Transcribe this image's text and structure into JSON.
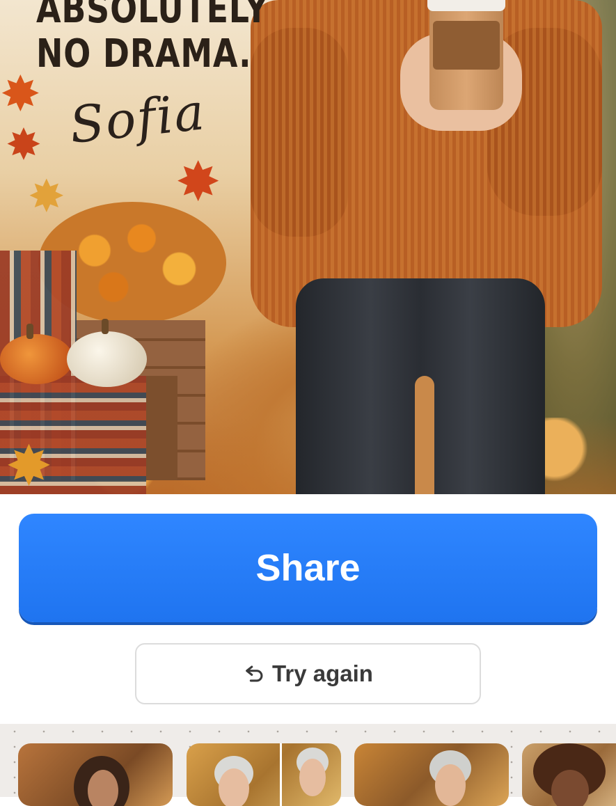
{
  "hero": {
    "headline_lines": [
      "ABSOLUTELY",
      "NO DRAMA."
    ],
    "signature": "Sofia"
  },
  "actions": {
    "share_label": "Share",
    "try_again_label": "Try again",
    "try_again_icon": "undo-arrow-icon"
  },
  "thumbnails": {
    "count_visible": 4
  },
  "colors": {
    "primary_button": "#1f74f0",
    "primary_button_text": "#ffffff",
    "secondary_border": "#dcdcdc",
    "secondary_text": "#3a3a3a"
  }
}
